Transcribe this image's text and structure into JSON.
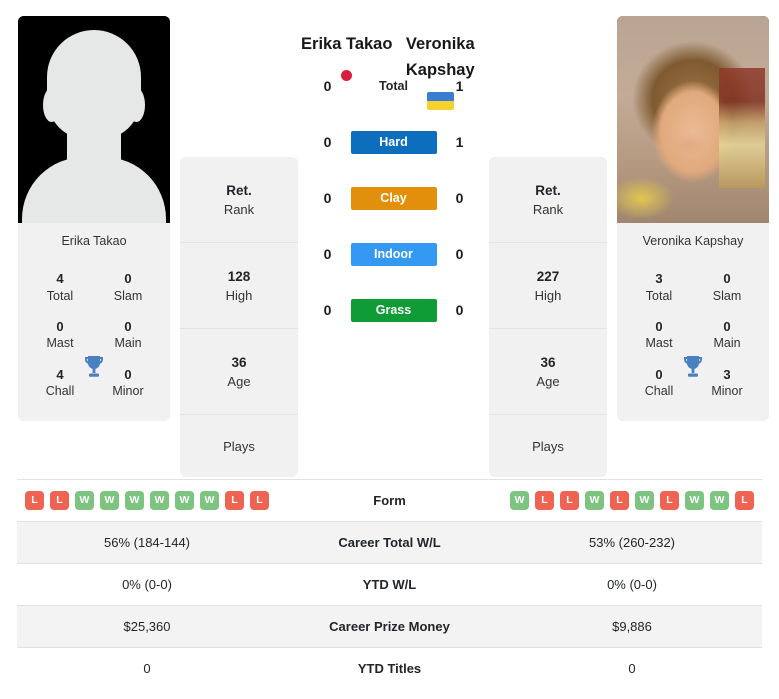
{
  "players": {
    "left": {
      "name": "Erika Takao",
      "caption": "Erika Takao",
      "flag": "flag-japan",
      "avatar": "silhouette-placeholder",
      "titles": {
        "total_value": "4",
        "total_label": "Total",
        "slam_value": "0",
        "slam_label": "Slam",
        "mast_value": "0",
        "mast_label": "Mast",
        "main_value": "0",
        "main_label": "Main",
        "chall_value": "4",
        "chall_label": "Chall",
        "minor_value": "0",
        "minor_label": "Minor",
        "trophy_icon": "trophy-icon"
      },
      "rank": {
        "current_value": "Ret.",
        "current_label": "Rank",
        "high_value": "128",
        "high_label": "High",
        "age_value": "36",
        "age_label": "Age",
        "plays_label": "Plays"
      },
      "surface_scores": [
        "0",
        "0",
        "0",
        "0",
        "0"
      ],
      "form": [
        "L",
        "L",
        "W",
        "W",
        "W",
        "W",
        "W",
        "W",
        "L",
        "L"
      ],
      "career_total_wl": "56% (184-144)",
      "ytd_wl": "0% (0-0)",
      "career_prize_money": "$25,360",
      "ytd_titles": "0"
    },
    "right": {
      "name": "Veronika Kapshay",
      "caption": "Veronika Kapshay",
      "flag": "flag-ukraine",
      "avatar": "player-photo",
      "titles": {
        "total_value": "3",
        "total_label": "Total",
        "slam_value": "0",
        "slam_label": "Slam",
        "mast_value": "0",
        "mast_label": "Mast",
        "main_value": "0",
        "main_label": "Main",
        "chall_value": "0",
        "chall_label": "Chall",
        "minor_value": "3",
        "minor_label": "Minor",
        "trophy_icon": "trophy-icon"
      },
      "rank": {
        "current_value": "Ret.",
        "current_label": "Rank",
        "high_value": "227",
        "high_label": "High",
        "age_value": "36",
        "age_label": "Age",
        "plays_label": "Plays"
      },
      "surface_scores": [
        "1",
        "1",
        "0",
        "0",
        "0"
      ],
      "form": [
        "W",
        "L",
        "L",
        "W",
        "L",
        "W",
        "L",
        "W",
        "W",
        "L"
      ],
      "career_total_wl": "53% (260-232)",
      "ytd_wl": "0% (0-0)",
      "career_prize_money": "$9,886",
      "ytd_titles": "0"
    }
  },
  "surfaces": [
    {
      "label": "Total",
      "color": "transparent",
      "plain": true
    },
    {
      "label": "Hard",
      "color": "#0d6ebd",
      "plain": false
    },
    {
      "label": "Clay",
      "color": "#e2900b",
      "plain": false
    },
    {
      "label": "Indoor",
      "color": "#3399f3",
      "plain": false
    },
    {
      "label": "Grass",
      "color": "#0f9c36",
      "plain": false
    }
  ],
  "stats_rows": [
    {
      "label": "Form"
    },
    {
      "label": "Career Total W/L"
    },
    {
      "label": "YTD W/L"
    },
    {
      "label": "Career Prize Money"
    },
    {
      "label": "YTD Titles"
    }
  ],
  "colors": {
    "hard": "#0d6ebd",
    "clay": "#e2900b",
    "indoor": "#3399f3",
    "grass": "#0f9c36",
    "win": "#7cc47f",
    "loss": "#ee6352",
    "panel": "#f1f1f1",
    "stripe": "#f3f3f3"
  }
}
